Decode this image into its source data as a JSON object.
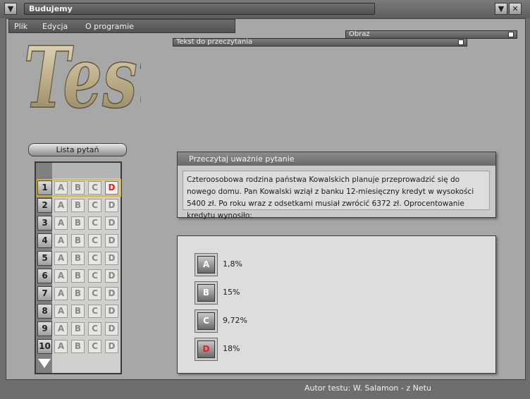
{
  "window": {
    "title": "Budujemy",
    "min_icon": "chevron-down-icon",
    "close_icon": "close-icon"
  },
  "menu": {
    "items": [
      "Plik",
      "Edycja",
      "O programie"
    ]
  },
  "panels": {
    "obraz": "Obraz",
    "tekst": "Tekst do przeczytania"
  },
  "logo": {
    "text": "Testy"
  },
  "question_list": {
    "label": "Lista pytań",
    "rows": [
      {
        "num": "1",
        "selected": "D"
      },
      {
        "num": "2",
        "selected": ""
      },
      {
        "num": "3",
        "selected": ""
      },
      {
        "num": "4",
        "selected": ""
      },
      {
        "num": "5",
        "selected": ""
      },
      {
        "num": "6",
        "selected": ""
      },
      {
        "num": "7",
        "selected": ""
      },
      {
        "num": "8",
        "selected": ""
      },
      {
        "num": "9",
        "selected": ""
      },
      {
        "num": "10",
        "selected": ""
      }
    ],
    "options": [
      "A",
      "B",
      "C",
      "D"
    ],
    "active_row": "1"
  },
  "question": {
    "header": "Przeczytaj uważnie pytanie",
    "text": "Czteroosobowa rodzina państwa Kowalskich planuje przeprowadzić się do nowego domu. Pan Kowalski wziął z banku 12-miesięczny kredyt w wysokości 5400 zł. Po roku wraz z odsetkami musiał zwrócić 6372 zł. Oprocentowanie kredytu wynosiło:"
  },
  "answers": [
    {
      "letter": "A",
      "text": "1,8%",
      "selected": false
    },
    {
      "letter": "B",
      "text": "15%",
      "selected": false
    },
    {
      "letter": "C",
      "text": "9,72%",
      "selected": false
    },
    {
      "letter": "D",
      "text": "18%",
      "selected": true
    }
  ],
  "footer": {
    "author": "Autor testu: W. Salamon - z Netu"
  },
  "colors": {
    "selected_answer": "#e02020",
    "active_outline": "#d7b83a"
  }
}
